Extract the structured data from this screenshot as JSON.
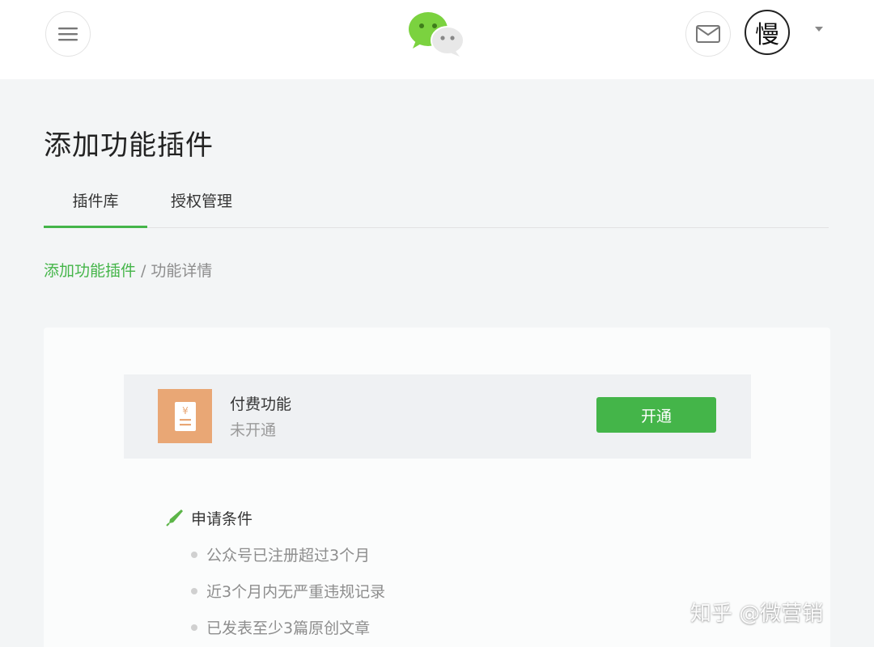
{
  "header": {
    "menu_icon": "hamburger-menu-icon",
    "logo": "wechat-logo",
    "mail_icon": "mail-icon",
    "avatar_text": "慢",
    "dropdown_icon": "caret-down-icon"
  },
  "page": {
    "title": "添加功能插件",
    "tabs": [
      {
        "label": "插件库",
        "active": true
      },
      {
        "label": "授权管理",
        "active": false
      }
    ],
    "breadcrumb": {
      "parent": "添加功能插件",
      "separator": "/",
      "current": "功能详情"
    }
  },
  "feature": {
    "icon": "yuan-receipt-icon",
    "name": "付费功能",
    "status": "未开通",
    "button_label": "开通"
  },
  "conditions": {
    "icon": "pen-icon",
    "title": "申请条件",
    "items": [
      "公众号已注册超过3个月",
      "近3个月内无严重违规记录",
      "已发表至少3篇原创文章"
    ]
  },
  "watermark": "知乎 @微营销",
  "colors": {
    "accent": "#44b549",
    "feature_icon_bg": "#e9a775",
    "page_bg": "#f3f5f6"
  }
}
